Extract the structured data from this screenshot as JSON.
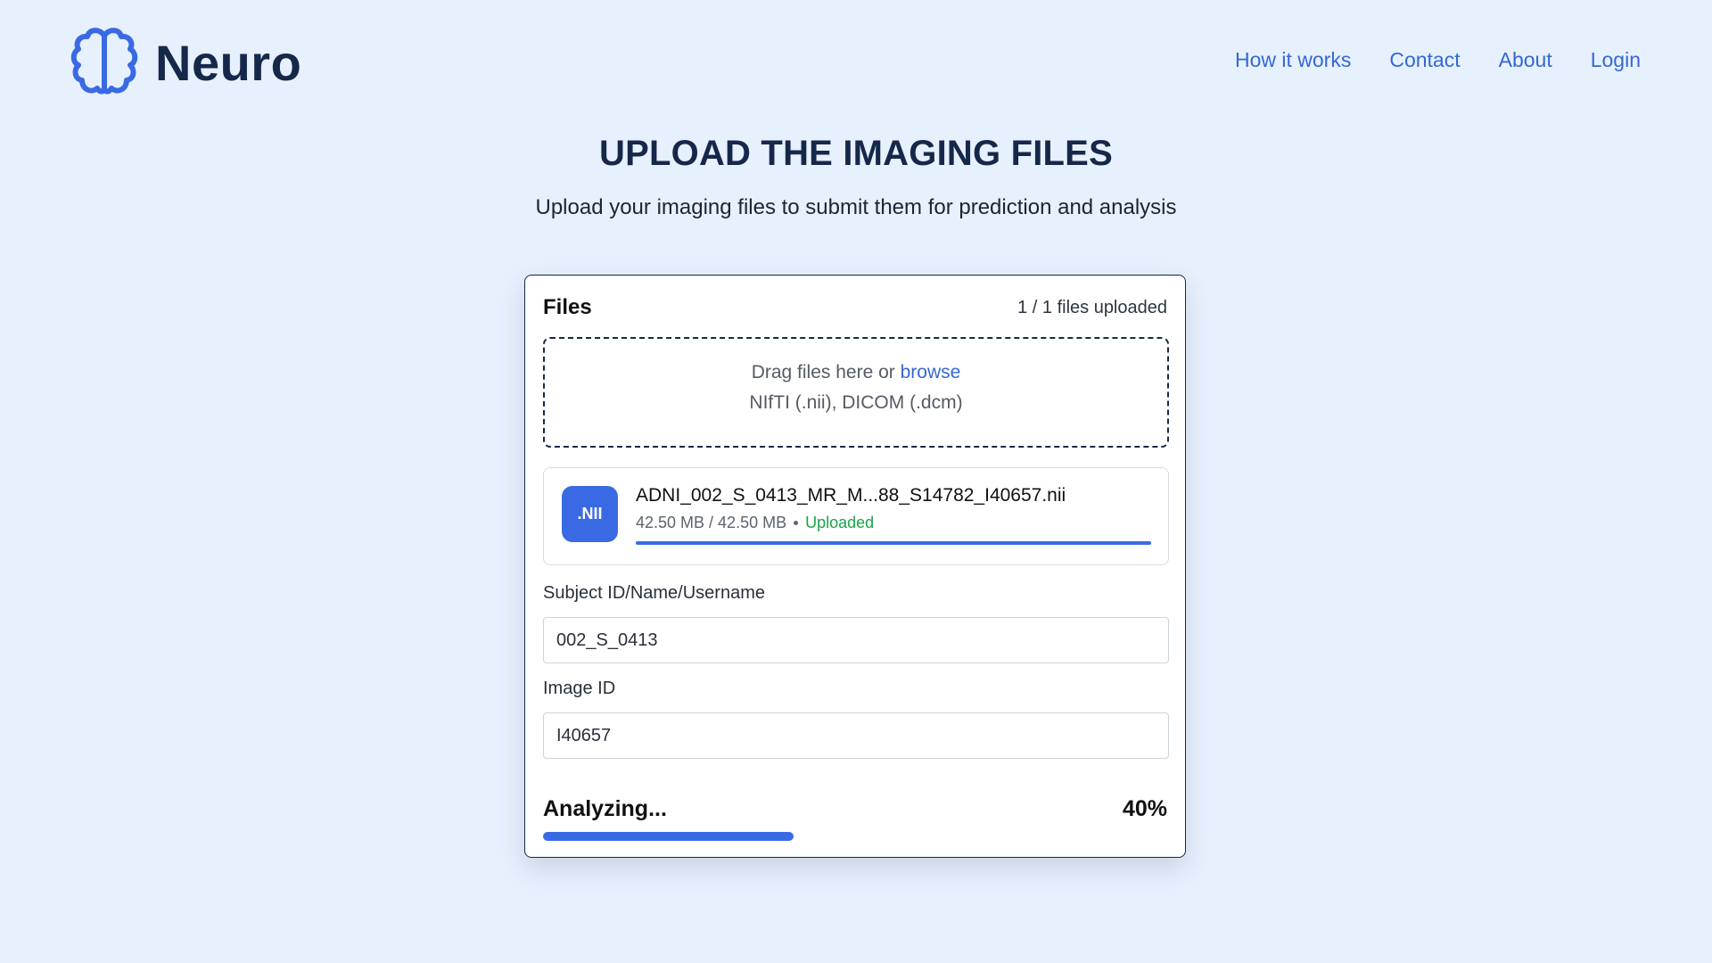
{
  "brand": {
    "name": "Neuro",
    "icon": "brain-icon",
    "accent_color": "#3a6ae3",
    "text_color": "#16284a"
  },
  "nav": {
    "items": [
      {
        "label": "How it works"
      },
      {
        "label": "Contact"
      },
      {
        "label": "About"
      },
      {
        "label": "Login"
      }
    ]
  },
  "page": {
    "title": "UPLOAD THE IMAGING FILES",
    "subtitle": "Upload your imaging files to submit them for prediction and analysis"
  },
  "upload": {
    "card_title": "Files",
    "files_count": "1 / 1 files uploaded",
    "dropzone": {
      "prefix": "Drag files here or ",
      "browse_label": "browse",
      "formats": "NIfTI (.nii), DICOM (.dcm)"
    },
    "file": {
      "badge": ".NII",
      "name": "ADNI_002_S_0413_MR_M...88_S14782_I40657.nii",
      "size": "42.50 MB / 42.50 MB",
      "status": "Uploaded",
      "status_color": "#1aa34a",
      "progress": 1.0
    }
  },
  "form": {
    "subject": {
      "label": "Subject ID/Name/Username",
      "value": "002_S_0413"
    },
    "image_id": {
      "label": "Image ID",
      "value": "I40657"
    }
  },
  "analysis": {
    "label": "Analyzing...",
    "percent_label": "40%",
    "progress": 0.4
  }
}
